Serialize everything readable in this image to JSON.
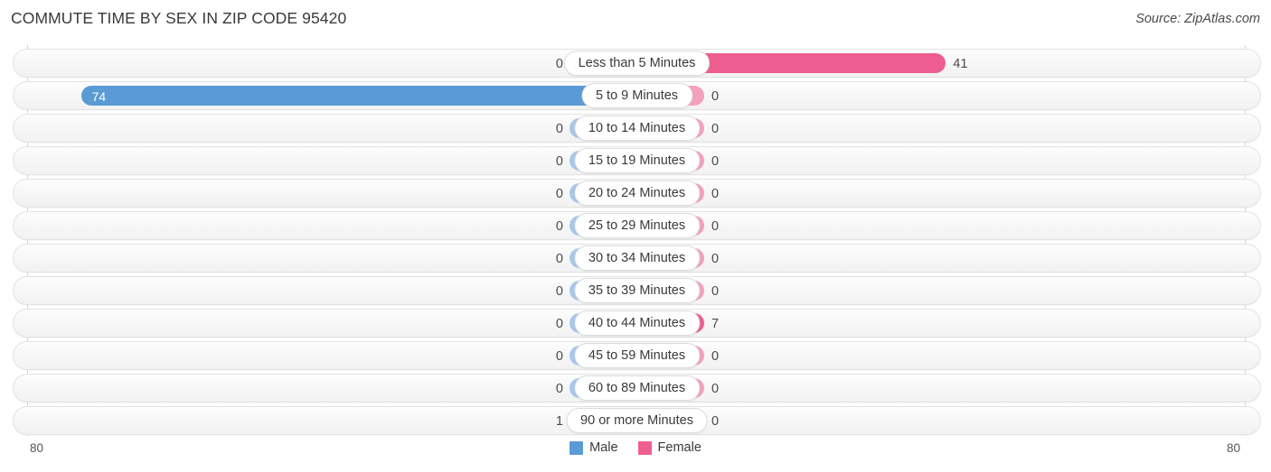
{
  "header": {
    "title": "COMMUTE TIME BY SEX IN ZIP CODE 95420",
    "source": "Source: ZipAtlas.com"
  },
  "axis": {
    "left_label": "80",
    "right_label": "80",
    "max": 80
  },
  "legend": {
    "items": [
      {
        "label": "Male",
        "color": "#5b9bd5",
        "icon": "male-color-swatch"
      },
      {
        "label": "Female",
        "color": "#ee5e91",
        "icon": "female-color-swatch"
      }
    ]
  },
  "colors": {
    "male": "#5b9bd5",
    "male_light": "#a8c8ea",
    "female": "#ee5e91",
    "female_light": "#f5a0be",
    "track": "#f7f7f7",
    "track_border": "#e3e3e3",
    "axis_line": "#d6d6d6"
  },
  "chart_data": {
    "type": "bar",
    "subtype": "diverging-butterfly",
    "title": "COMMUTE TIME BY SEX IN ZIP CODE 95420",
    "xlabel": "",
    "ylabel": "",
    "xlim": [
      80,
      0,
      80
    ],
    "grid": false,
    "legend_position": "bottom-center",
    "categories": [
      "Less than 5 Minutes",
      "5 to 9 Minutes",
      "10 to 14 Minutes",
      "15 to 19 Minutes",
      "20 to 24 Minutes",
      "25 to 29 Minutes",
      "30 to 34 Minutes",
      "35 to 39 Minutes",
      "40 to 44 Minutes",
      "45 to 59 Minutes",
      "60 to 89 Minutes",
      "90 or more Minutes"
    ],
    "series": [
      {
        "name": "Male",
        "values": [
          0,
          74,
          0,
          0,
          0,
          0,
          0,
          0,
          0,
          0,
          0,
          1
        ]
      },
      {
        "name": "Female",
        "values": [
          41,
          0,
          0,
          0,
          0,
          0,
          0,
          7,
          0,
          0,
          0,
          0
        ]
      }
    ]
  },
  "rows": [
    {
      "category": "Less than 5 Minutes",
      "male": "0",
      "female": "41",
      "male_val": 0,
      "female_val": 41
    },
    {
      "category": "5 to 9 Minutes",
      "male": "74",
      "female": "0",
      "male_val": 74,
      "female_val": 0
    },
    {
      "category": "10 to 14 Minutes",
      "male": "0",
      "female": "0",
      "male_val": 0,
      "female_val": 0
    },
    {
      "category": "15 to 19 Minutes",
      "male": "0",
      "female": "0",
      "male_val": 0,
      "female_val": 0
    },
    {
      "category": "20 to 24 Minutes",
      "male": "0",
      "female": "0",
      "male_val": 0,
      "female_val": 0
    },
    {
      "category": "25 to 29 Minutes",
      "male": "0",
      "female": "0",
      "male_val": 0,
      "female_val": 0
    },
    {
      "category": "30 to 34 Minutes",
      "male": "0",
      "female": "0",
      "male_val": 0,
      "female_val": 0
    },
    {
      "category": "35 to 39 Minutes",
      "male": "0",
      "female": "0",
      "male_val": 0,
      "female_val": 0
    },
    {
      "category": "40 to 44 Minutes",
      "male": "0",
      "female": "7",
      "male_val": 0,
      "female_val": 7
    },
    {
      "category": "45 to 59 Minutes",
      "male": "0",
      "female": "0",
      "male_val": 0,
      "female_val": 0
    },
    {
      "category": "60 to 89 Minutes",
      "male": "0",
      "female": "0",
      "male_val": 0,
      "female_val": 0
    },
    {
      "category": "90 or more Minutes",
      "male": "1",
      "female": "0",
      "male_val": 1,
      "female_val": 0
    }
  ]
}
